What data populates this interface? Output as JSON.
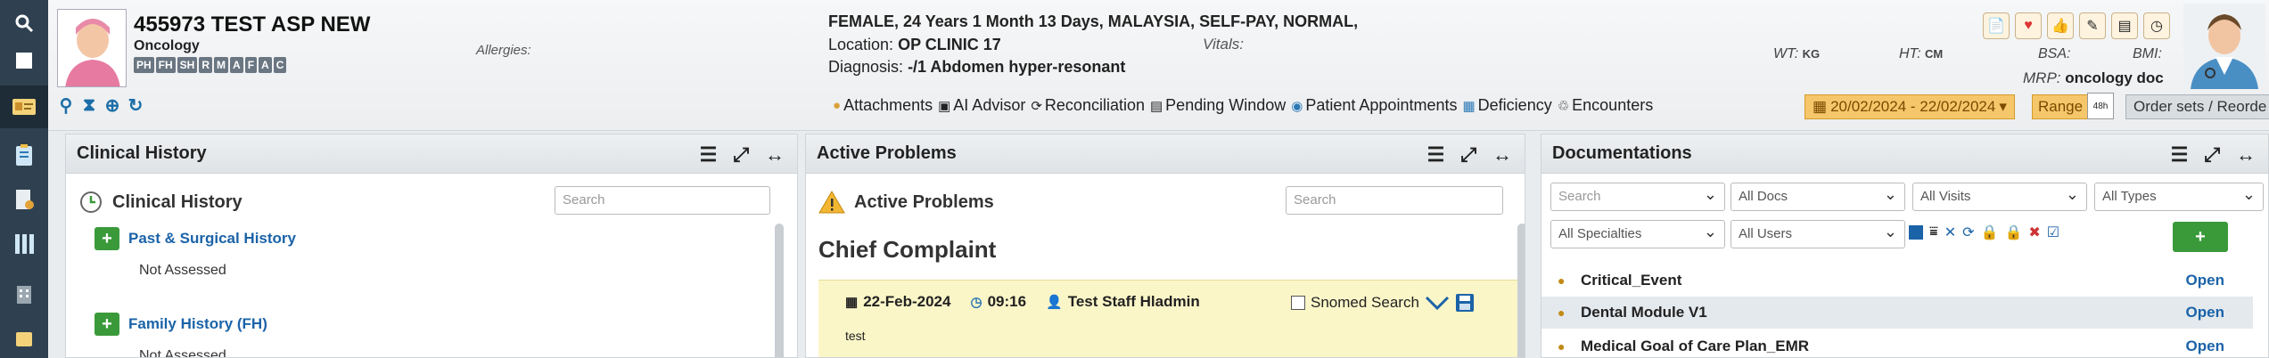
{
  "colors": {
    "rail": "#2f4150",
    "link": "#1b63a8",
    "accent": "#3a9a3a",
    "entry_bg": "#fbf6c8",
    "date_bg": "#f6c76a"
  },
  "rail": {
    "icons": [
      "search-icon",
      "square-icon",
      "id-card-icon",
      "clipboard-icon",
      "note-icon",
      "columns-icon",
      "building-icon",
      "more-icon"
    ]
  },
  "patient": {
    "name": "455973 TEST ASP NEW",
    "department": "Oncology",
    "badges": [
      "PH",
      "FH",
      "SH",
      "R",
      "M",
      "A",
      "F",
      "A",
      "C"
    ],
    "allergies_label": "Allergies:",
    "demographics": "FEMALE, 24 Years 1 Month 13 Days, MALAYSIA, SELF-PAY, NORMAL,",
    "location_label": "Location:",
    "location": "OP CLINIC 17",
    "diagnosis_label": "Diagnosis:",
    "diagnosis": "-/1 Abdomen hyper-resonant",
    "vitals_label": "Vitals:",
    "wt_label": "WT:",
    "wt_unit": "KG",
    "ht_label": "HT:",
    "ht_unit": "CM",
    "bsa_label": "BSA:",
    "bmi_label": "BMI:",
    "mrp_label": "MRP:",
    "mrp": "oncology doc"
  },
  "toolbar": {
    "items": [
      {
        "label": "Attachments",
        "icon": "paperclip-icon"
      },
      {
        "label": "AI Advisor",
        "icon": "ai-icon"
      },
      {
        "label": "Reconciliation",
        "icon": "reconcile-icon"
      },
      {
        "label": "Pending Window",
        "icon": "pending-icon"
      },
      {
        "label": "Patient Appointments",
        "icon": "appointment-icon"
      },
      {
        "label": "Deficiency",
        "icon": "deficiency-icon"
      },
      {
        "label": "Encounters",
        "icon": "encounters-icon"
      }
    ],
    "date_range": "20/02/2024 - 22/02/2024",
    "range_label": "Range",
    "cal_label": "48h",
    "order_sets": "Order sets / Reorde"
  },
  "clinical": {
    "title": "Clinical History",
    "subtitle": "Clinical History",
    "search_placeholder": "Search",
    "items": [
      {
        "label": "Past & Surgical History",
        "status": "Not Assessed"
      },
      {
        "label": "Family History (FH)",
        "status": "Not Assessed"
      }
    ]
  },
  "problems": {
    "title": "Active Problems",
    "subtitle": "Active Problems",
    "search_placeholder": "Search",
    "chief": "Chief Complaint",
    "entry": {
      "date": "22-Feb-2024",
      "time": "09:16",
      "user": "Test Staff Hladmin",
      "snomed": "Snomed Search",
      "text": "test"
    }
  },
  "docs": {
    "title": "Documentations",
    "search_placeholder": "Search",
    "filters": [
      "All Docs",
      "All Visits",
      "All Types",
      "All Specialties",
      "All Users"
    ],
    "items": [
      {
        "name": "Critical_Event",
        "action": "Open"
      },
      {
        "name": "Dental Module V1",
        "action": "Open"
      },
      {
        "name": "Medical Goal of Care Plan_EMR",
        "action": "Open"
      }
    ]
  }
}
